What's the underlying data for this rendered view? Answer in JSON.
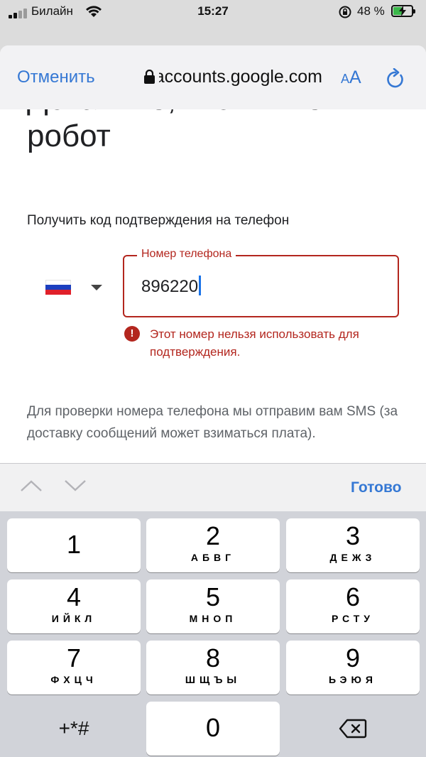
{
  "status_bar": {
    "carrier": "Билайн",
    "time": "15:27",
    "battery_percent": "48 %",
    "battery_level": 0.48
  },
  "browser": {
    "cancel_label": "Отменить",
    "url": "accounts.google.com",
    "text_size_small": "A",
    "text_size_big": "A"
  },
  "page": {
    "title": "Докажите, что вы не робот",
    "subtitle": "Получить код подтверждения на телефон",
    "phone_field": {
      "label": "Номер телефона",
      "value": "896220"
    },
    "error_icon_glyph": "!",
    "error_message": "Этот номер нельзя использовать для подтверждения.",
    "sms_note": "Для проверки номера телефона мы отправим вам SMS (за доставку сообщений может взиматься плата)."
  },
  "keyboard": {
    "done_label": "Готово",
    "keys": [
      {
        "digit": "1",
        "letters": ""
      },
      {
        "digit": "2",
        "letters": "АБВГ"
      },
      {
        "digit": "3",
        "letters": "ДЕЖЗ"
      },
      {
        "digit": "4",
        "letters": "ИЙКЛ"
      },
      {
        "digit": "5",
        "letters": "МНОП"
      },
      {
        "digit": "6",
        "letters": "РСТУ"
      },
      {
        "digit": "7",
        "letters": "ФХЦЧ"
      },
      {
        "digit": "8",
        "letters": "ШЩЪЫ"
      },
      {
        "digit": "9",
        "letters": "ЬЭЮЯ"
      },
      {
        "digit": "0",
        "letters": ""
      }
    ],
    "symbols_label": "+*#"
  },
  "colors": {
    "accent": "#3578d4",
    "error": "#b3261e",
    "battery": "#3bb84a"
  }
}
